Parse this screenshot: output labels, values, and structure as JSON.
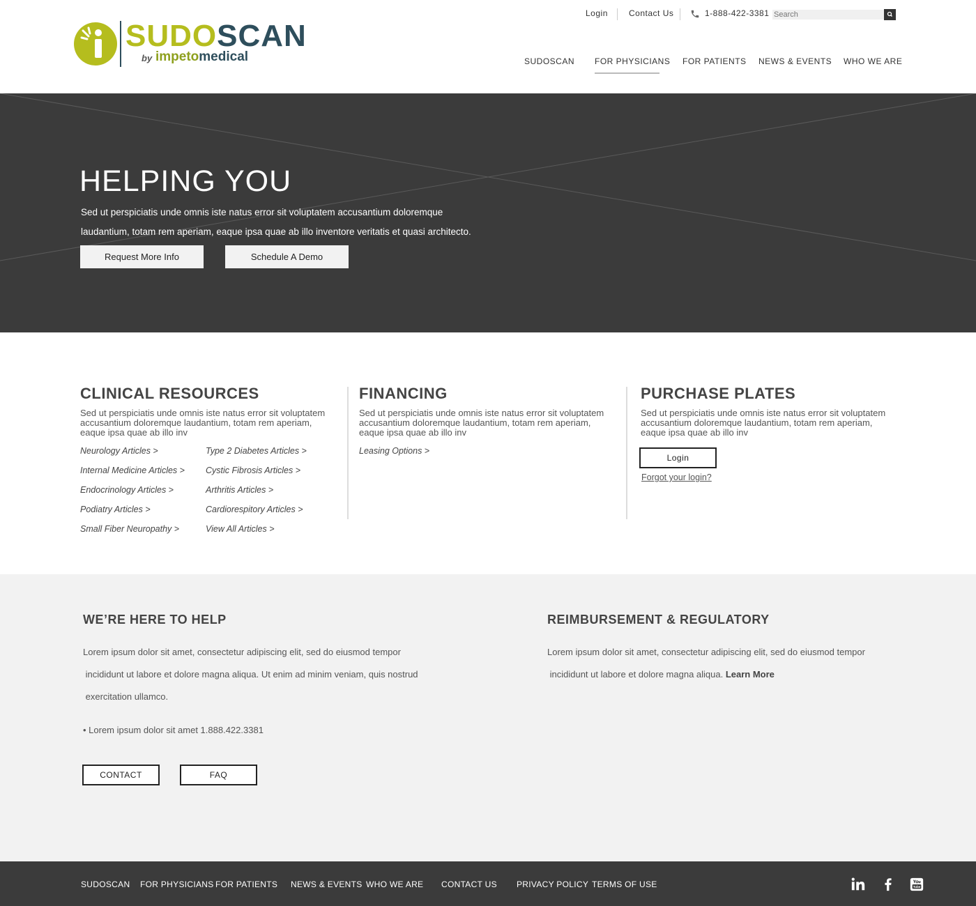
{
  "brand": {
    "name_part1": "SUDO",
    "name_part2": "SCAN",
    "by": "by",
    "company_part1": "impeto",
    "company_part2": "medical",
    "accent_color": "#b5bd1e",
    "navy_color": "#2e4e5c"
  },
  "utility": {
    "login": "Login",
    "contact": "Contact Us",
    "phone": "1-888-422-3381",
    "search_placeholder": "Search"
  },
  "nav": {
    "items": [
      "SUDOSCAN",
      "FOR PHYSICIANS",
      "FOR PATIENTS",
      "NEWS & EVENTS",
      "WHO WE ARE"
    ],
    "active": "FOR PHYSICIANS"
  },
  "hero": {
    "title": "HELPING YOU",
    "line1": "Sed ut perspiciatis unde omnis iste natus error sit voluptatem accusantium doloremque",
    "line2": "laudantium, totam rem aperiam, eaque ipsa quae ab illo inventore veritatis et quasi architecto.",
    "btn_request": "Request More Info",
    "btn_demo": "Schedule A Demo",
    "bg_color": "#3b3b3b"
  },
  "clinical": {
    "title": "CLINICAL RESOURCES",
    "text": "Sed ut perspiciatis unde omnis iste natus error sit voluptatem accusantium doloremque laudantium, totam rem aperiam, eaque ipsa quae ab illo inv",
    "links_left": [
      "Neurology Articles >",
      "Internal Medicine Articles >",
      "Endocrinology Articles >",
      "Podiatry Articles >",
      "Small Fiber Neuropathy >"
    ],
    "links_right": [
      "Type 2 Diabetes  Articles >",
      "Cystic Fibrosis Articles >",
      "Arthritis Articles >",
      "Cardiorespitory Articles >",
      "View All Articles >"
    ]
  },
  "financing": {
    "title": "FINANCING",
    "text": "Sed ut perspiciatis unde omnis iste natus error sit voluptatem accusantium doloremque laudantium, totam rem aperiam, eaque ipsa quae ab illo inv",
    "link": "Leasing Options >"
  },
  "purchase": {
    "title": "PURCHASE PLATES",
    "text": "Sed ut perspiciatis unde omnis iste natus error sit voluptatem accusantium doloremque laudantium, totam rem aperiam, eaque ipsa quae ab illo inv",
    "login_btn": "Login",
    "forgot": "Forgot your login?"
  },
  "help": {
    "title": "WE’RE HERE TO HELP",
    "line1": "Lorem ipsum dolor sit amet, consectetur adipiscing elit, sed do eiusmod tempor",
    "line2": " incididunt ut labore et dolore magna aliqua. Ut enim ad minim veniam, quis nostrud",
    "line3": " exercitation ullamco.",
    "bullet": "• Lorem ipsum dolor sit amet 1.888.422.3381",
    "btn_contact": "CONTACT",
    "btn_faq": "FAQ"
  },
  "reimbursement": {
    "title": "REIMBURSEMENT & REGULATORY",
    "line1": "Lorem ipsum dolor sit amet, consectetur adipiscing elit, sed do eiusmod tempor",
    "line2": " incididunt ut labore et dolore magna aliqua. ",
    "learn_more": "Learn More"
  },
  "footer": {
    "links": [
      "SUDOSCAN",
      "FOR PHYSICIANS",
      "FOR PATIENTS",
      "NEWS & EVENTS",
      "WHO WE ARE",
      "CONTACT US",
      "PRIVACY POLICY",
      "TERMS OF USE"
    ],
    "social_icons": [
      "linkedin-icon",
      "facebook-icon",
      "youtube-icon"
    ]
  }
}
